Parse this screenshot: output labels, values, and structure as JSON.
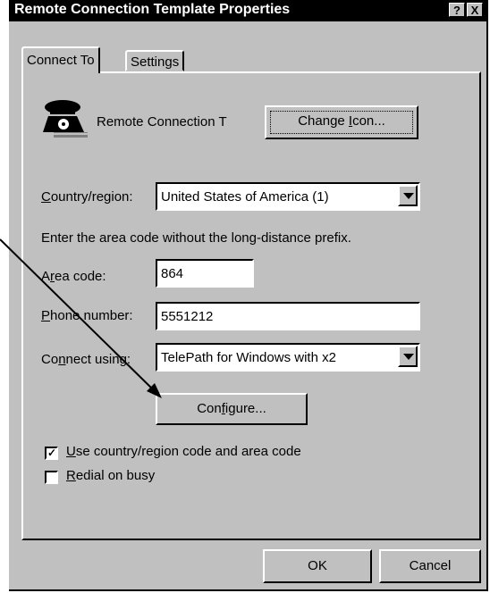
{
  "window": {
    "title": "Remote Connection Template Properties",
    "help_button": "?",
    "close_button": "X"
  },
  "tabs": [
    {
      "label": "Connect To",
      "active": true
    },
    {
      "label": "Settings",
      "active": false
    }
  ],
  "connection": {
    "icon": "telephone-icon",
    "name": "Remote Connection T",
    "change_icon_pre": "Change ",
    "change_icon_u": "I",
    "change_icon_post": "con..."
  },
  "country": {
    "label_u": "C",
    "label_rest": "ountry/region:",
    "value": "United States of America (1)"
  },
  "instruction": "Enter the area code without the long-distance prefix.",
  "area_code": {
    "label_pre": "A",
    "label_u": "r",
    "label_post": "ea code:",
    "value": "864"
  },
  "phone": {
    "label_u": "P",
    "label_rest": "hone number:",
    "value": "5551212"
  },
  "connect_using": {
    "label_pre": "Co",
    "label_u": "n",
    "label_post": "nect using:",
    "value": "TelePath for Windows with x2"
  },
  "configure": {
    "pre": "Con",
    "u": "f",
    "post": "igure..."
  },
  "options": [
    {
      "u": "U",
      "rest": "se country/region code and area code",
      "checked": true
    },
    {
      "u": "R",
      "rest": "edial on busy",
      "checked": false
    }
  ],
  "buttons": {
    "ok": "OK",
    "cancel": "Cancel"
  },
  "colors": {
    "face": "#c0c0c0",
    "titlebar": "#000000",
    "field": "#ffffff"
  }
}
